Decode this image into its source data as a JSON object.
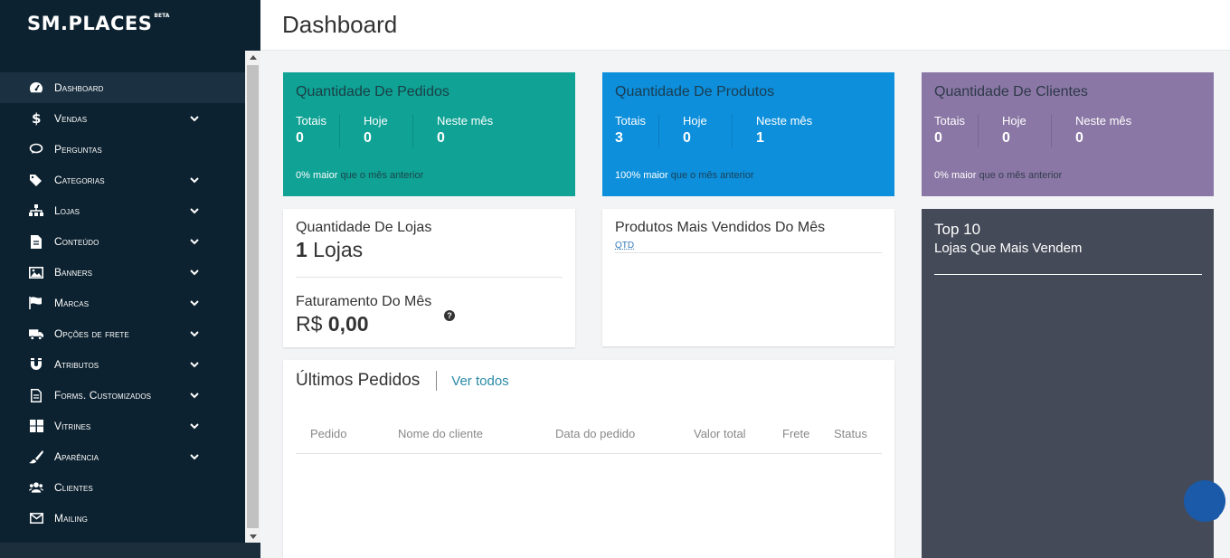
{
  "app": {
    "logo": "SM.PLACES",
    "logo_badge": "BETA"
  },
  "header": {
    "title": "Dashboard"
  },
  "sidebar": {
    "items": [
      {
        "label": "Dashboard",
        "icon": "dashboard-icon",
        "active": true,
        "has_submenu": false
      },
      {
        "label": "Vendas",
        "icon": "dollar-icon",
        "has_submenu": true
      },
      {
        "label": "Perguntas",
        "icon": "comments-icon",
        "has_submenu": false
      },
      {
        "label": "Categorias",
        "icon": "tags-icon",
        "has_submenu": true
      },
      {
        "label": "Lojas",
        "icon": "sitemap-icon",
        "has_submenu": true
      },
      {
        "label": "Conteúdo",
        "icon": "file-icon",
        "has_submenu": true
      },
      {
        "label": "Banners",
        "icon": "image-icon",
        "has_submenu": true
      },
      {
        "label": "Marcas",
        "icon": "flag-icon",
        "has_submenu": true
      },
      {
        "label": "Opções de frete",
        "icon": "truck-icon",
        "has_submenu": true
      },
      {
        "label": "Atributos",
        "icon": "magnet-icon",
        "has_submenu": true
      },
      {
        "label": "Forms. Customizados",
        "icon": "file-text-icon",
        "has_submenu": true
      },
      {
        "label": "Vitrines",
        "icon": "windows-icon",
        "has_submenu": true
      },
      {
        "label": "Aparência",
        "icon": "brush-icon",
        "has_submenu": true
      },
      {
        "label": "Clientes",
        "icon": "users-icon",
        "has_submenu": false
      },
      {
        "label": "Mailing",
        "icon": "envelope-icon",
        "has_submenu": false
      }
    ]
  },
  "stats": {
    "pedidos": {
      "title": "Quantidade De Pedidos",
      "color": "#0fa295",
      "cols": [
        {
          "k": "Totais",
          "v": "0"
        },
        {
          "k": "Hoje",
          "v": "0"
        },
        {
          "k": "Neste mês",
          "v": "0"
        }
      ],
      "foot_bold": "0% maior",
      "foot_rest": " que o mês anterior"
    },
    "produtos": {
      "title": "Quantidade De Produtos",
      "color": "#0d8fdb",
      "cols": [
        {
          "k": "Totais",
          "v": "3"
        },
        {
          "k": "Hoje",
          "v": "0"
        },
        {
          "k": "Neste mês",
          "v": "1"
        }
      ],
      "foot_bold": "100% maior",
      "foot_rest": " que o mês anterior"
    },
    "clientes": {
      "title": "Quantidade De Clientes",
      "color": "#8a77a5",
      "cols": [
        {
          "k": "Totais",
          "v": "0"
        },
        {
          "k": "Hoje",
          "v": "0"
        },
        {
          "k": "Neste mês",
          "v": "0"
        }
      ],
      "foot_bold": "0% maior",
      "foot_rest": " que o mês anterior"
    }
  },
  "lojas": {
    "title": "Quantidade De Lojas",
    "count": "1",
    "count_unit": " Lojas",
    "faturamento_title": "Faturamento Do Mês",
    "currency": "R$ ",
    "faturamento_value": "0,00"
  },
  "mais_vendidos": {
    "title": "Produtos Mais Vendidos Do Mês",
    "qtd_label": "QTD"
  },
  "ultimos_pedidos": {
    "title": "Últimos Pedidos",
    "link": "Ver todos",
    "columns": [
      "Pedido",
      "Nome do cliente",
      "Data do pedido",
      "Valor total",
      "Frete",
      "Status"
    ]
  },
  "top10": {
    "title": "Top 10",
    "subtitle": "Lojas Que Mais Vendem"
  }
}
